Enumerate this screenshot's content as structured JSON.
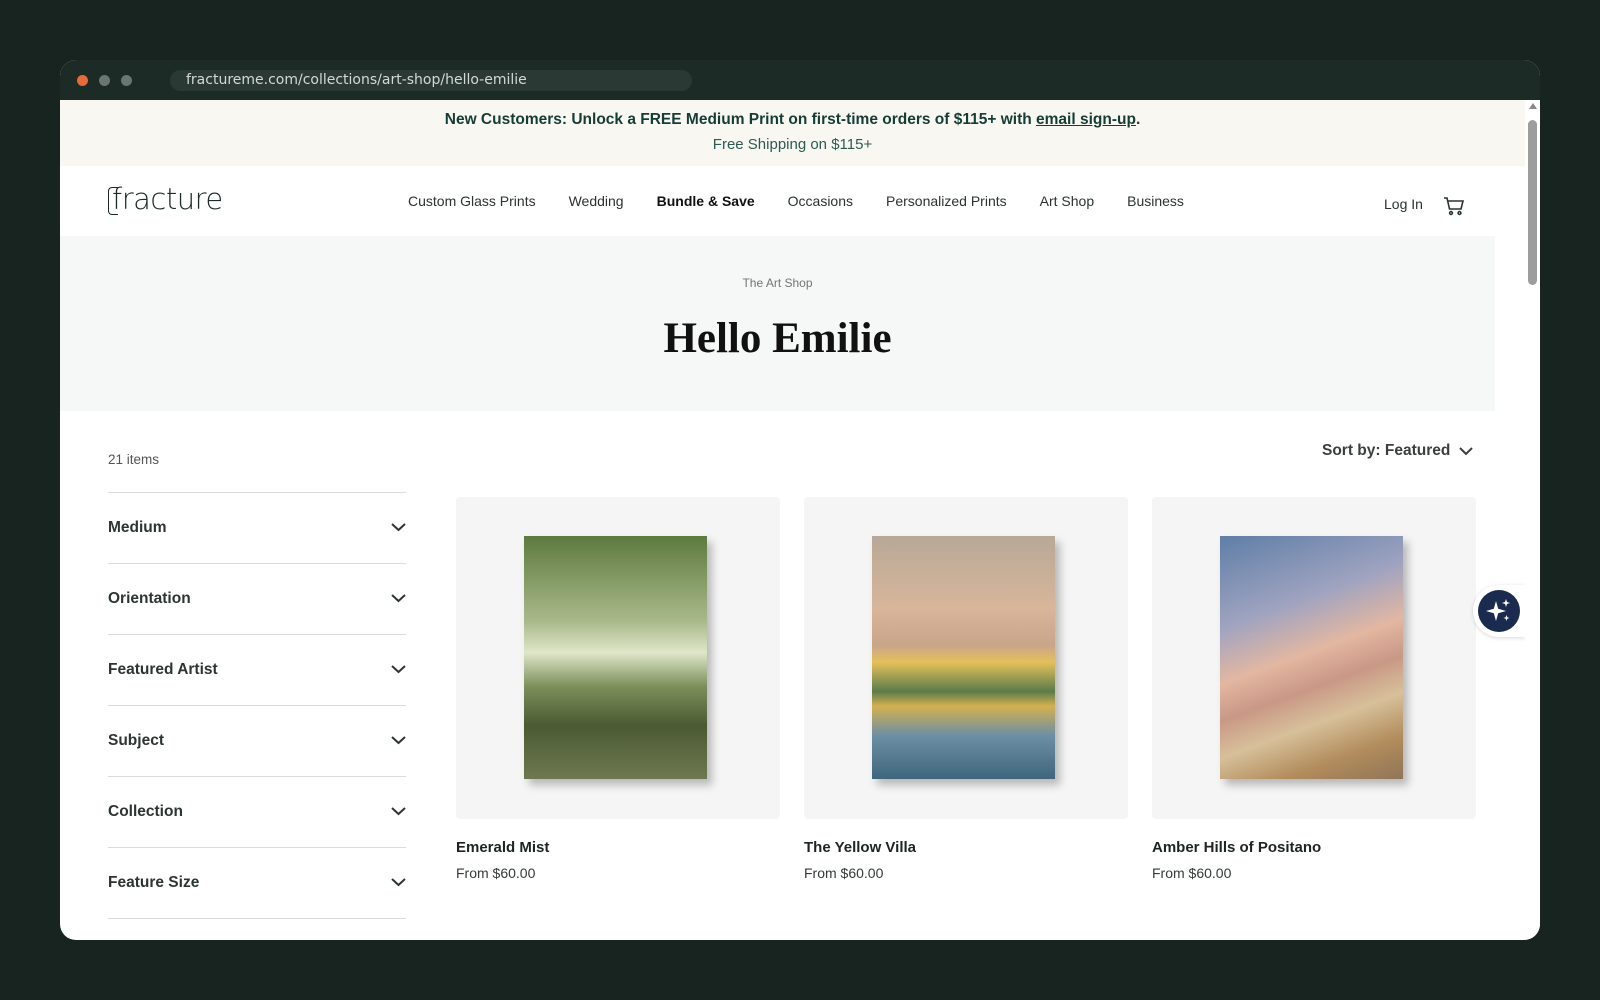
{
  "browser": {
    "url": "fractureme.com/collections/art-shop/hello-emilie"
  },
  "announcement": {
    "line1_prefix": "New Customers: Unlock a FREE Medium Print on first-time orders of $115+ with ",
    "line1_link": "email sign-up",
    "line1_suffix": ".",
    "line2": "Free Shipping on $115+"
  },
  "header": {
    "logo": "fracture",
    "nav": [
      "Custom Glass Prints",
      "Wedding",
      "Bundle & Save",
      "Occasions",
      "Personalized Prints",
      "Art Shop",
      "Business"
    ],
    "login": "Log In",
    "icons": {
      "cart": "cart-icon"
    }
  },
  "hero": {
    "breadcrumb": "The Art Shop",
    "title": "Hello Emilie"
  },
  "listing": {
    "count": "21 items",
    "sort_label": "Sort by: Featured"
  },
  "filters": [
    "Medium",
    "Orientation",
    "Featured Artist",
    "Subject",
    "Collection",
    "Feature Size"
  ],
  "products": [
    {
      "name": "Emerald Mist",
      "price": "From $60.00"
    },
    {
      "name": "The Yellow Villa",
      "price": "From $60.00"
    },
    {
      "name": "Amber Hills of Positano",
      "price": "From $60.00"
    }
  ],
  "colors": {
    "announcement_bg": "#f9f7f2",
    "brand_text": "#163c36",
    "hero_bg": "#f6f7f7",
    "ai_button": "#1a2b4f",
    "chat_button": "#2e7a5f"
  }
}
